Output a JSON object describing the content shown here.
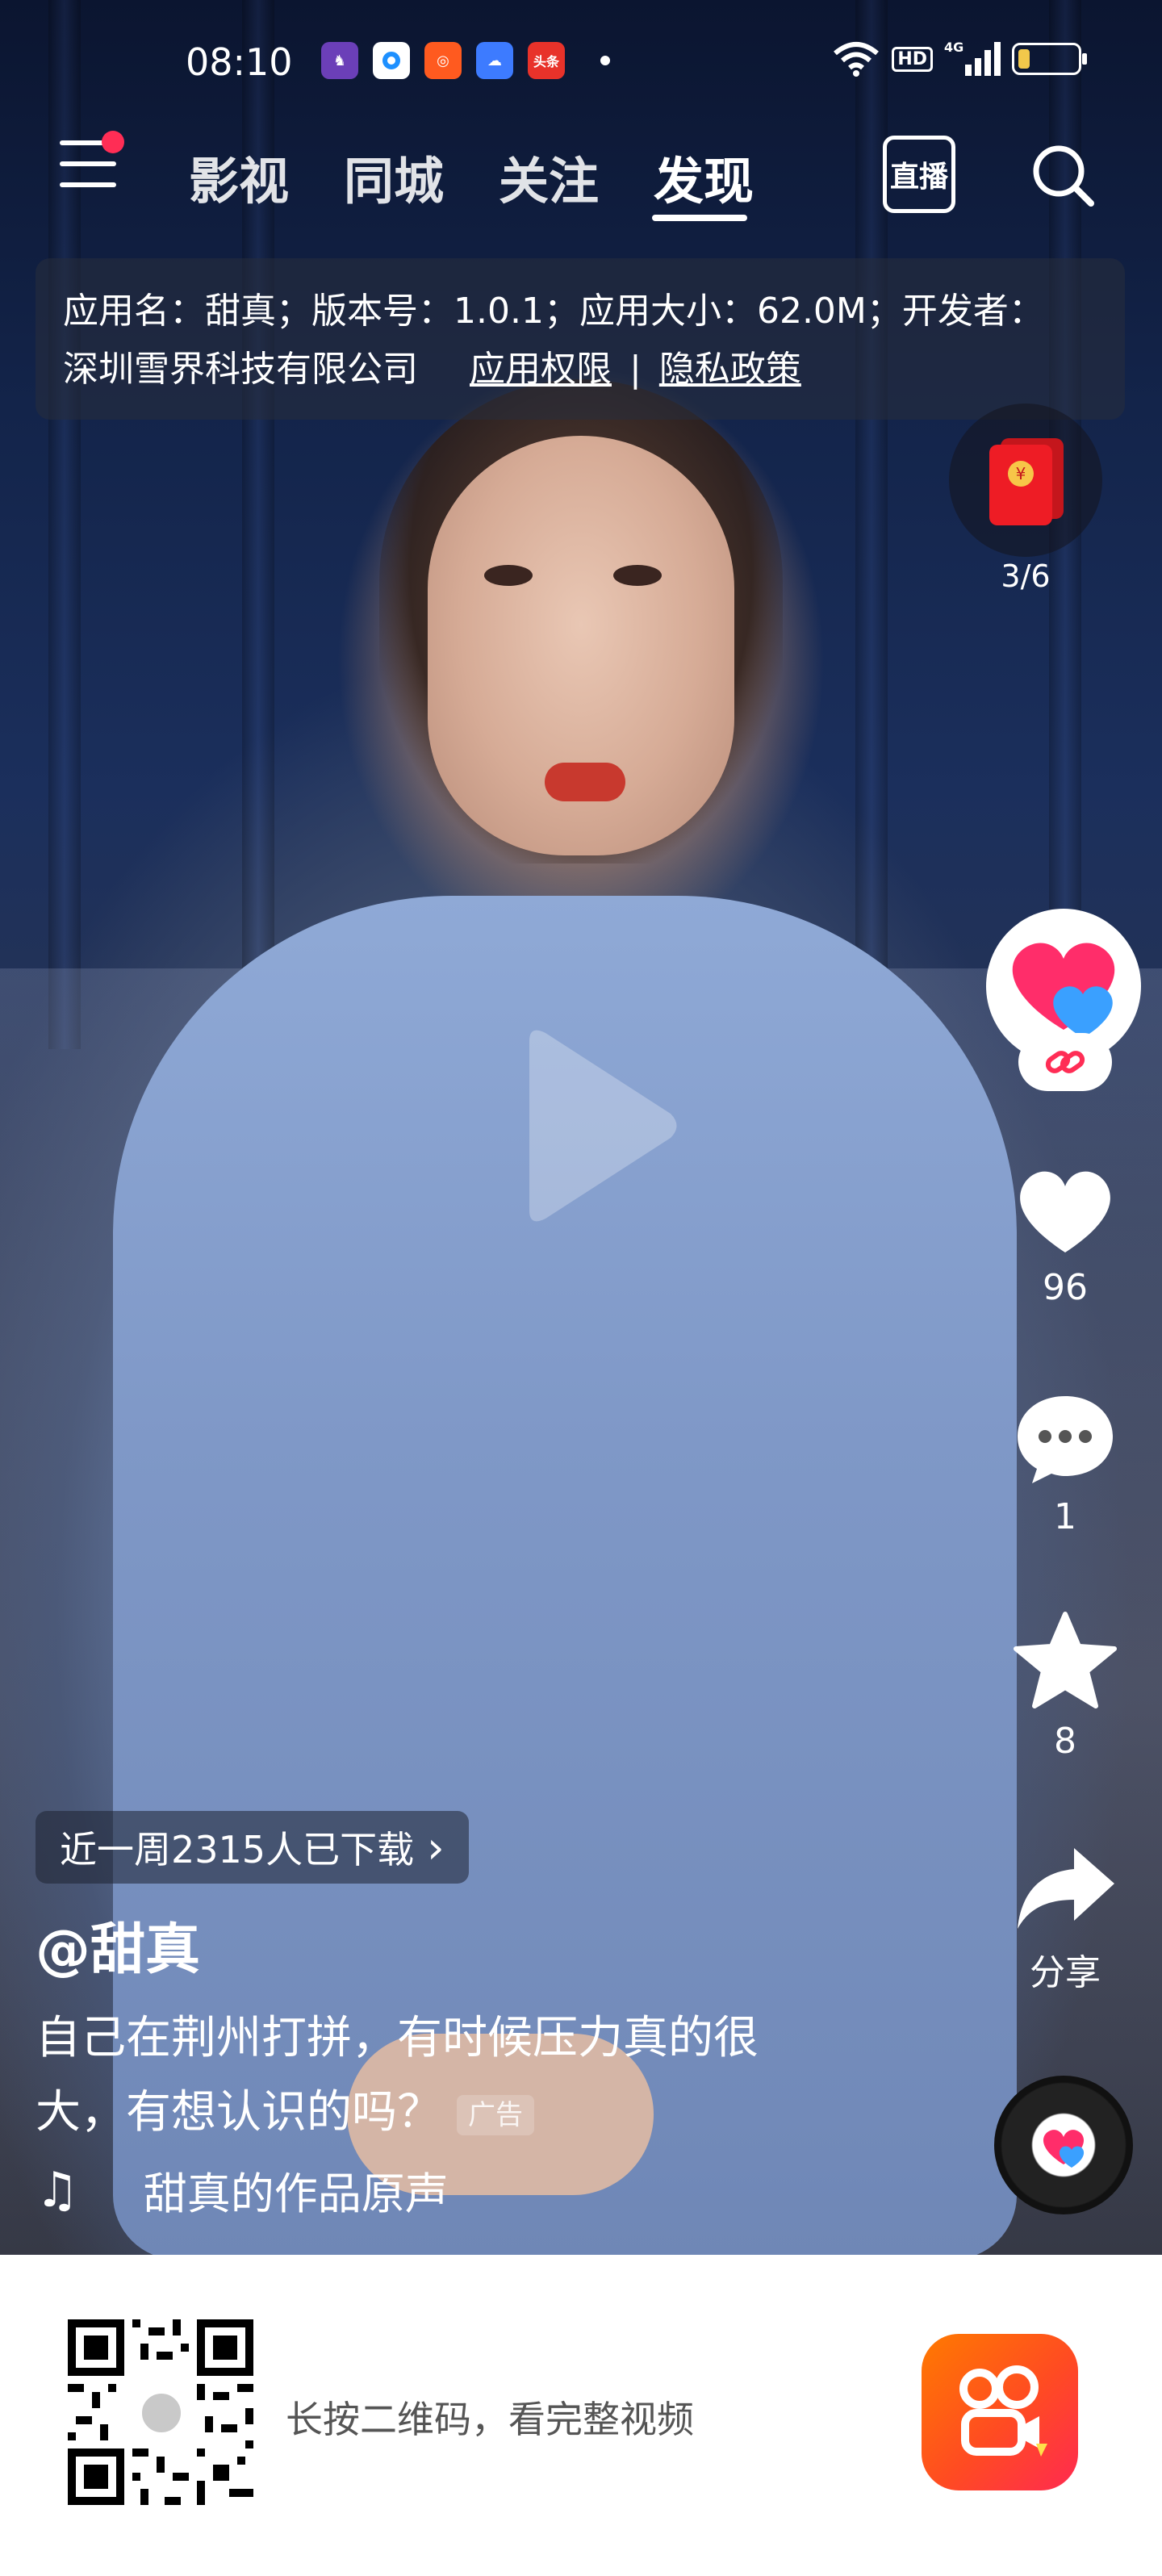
{
  "status_bar": {
    "time": "08:10",
    "apps": [
      {
        "icon": "game-app-icon",
        "color": "#6b3fb8"
      },
      {
        "icon": "browser-app-icon",
        "color": "#1e90ff"
      },
      {
        "icon": "kuaishou-app-icon",
        "color": "#ff5a1f"
      },
      {
        "icon": "cloud-app-icon",
        "color": "#3d7bff"
      },
      {
        "icon": "toutiao-app-icon",
        "color": "#e8322a",
        "text": "头条"
      }
    ],
    "network": "4G",
    "hd": "HD",
    "battery_level": 0.2
  },
  "topnav": {
    "tabs": [
      {
        "label": "影视",
        "active": false
      },
      {
        "label": "同城",
        "active": false
      },
      {
        "label": "关注",
        "active": false
      },
      {
        "label": "发现",
        "active": true
      }
    ],
    "live_label": "直播"
  },
  "app_info": {
    "line1": "应用名：甜真；版本号：1.0.1；应用大小：62.0M；开发者：",
    "developer": "深圳雪界科技有限公司",
    "permissions": "应用权限",
    "divider": "|",
    "privacy": "隐私政策"
  },
  "redpacket": {
    "count": "3/6"
  },
  "actions": {
    "likes": "96",
    "comments": "1",
    "favorites": "8",
    "share_label": "分享"
  },
  "overlay": {
    "download_text": "近一周2315人已下载",
    "chevron": "›",
    "author": "@甜真",
    "caption": "自己在荆州打拼，有时候压力真的很大，有想认识的吗？",
    "ad_tag": "广告",
    "music": "甜真的作品原声"
  },
  "bottom": {
    "qr_hint": "长按二维码，看完整视频"
  },
  "colors": {
    "accent_red": "#ff2d55",
    "kuaishou_orange": "#ff5a1f"
  }
}
